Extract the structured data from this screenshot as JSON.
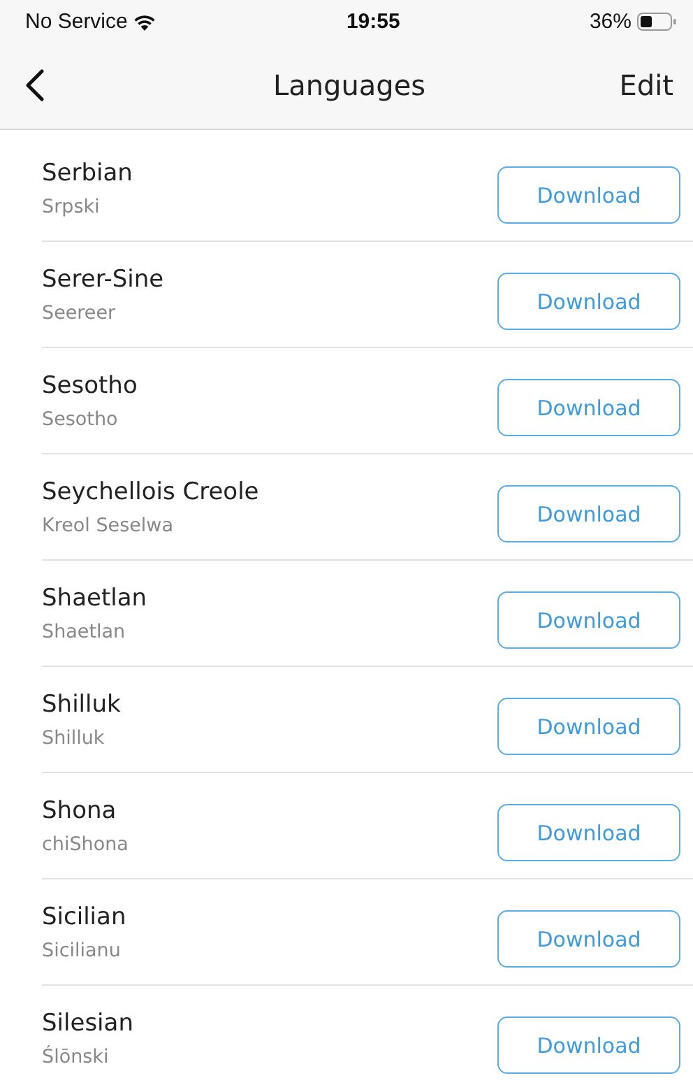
{
  "status_bar": {
    "carrier": "No Service",
    "time": "19:55",
    "battery": "36%"
  },
  "nav": {
    "title": "Languages",
    "action": "Edit"
  },
  "languages": [
    {
      "name": "Serbian",
      "native": "Srpski",
      "action": "Download"
    },
    {
      "name": "Serer-Sine",
      "native": "Seereer",
      "action": "Download"
    },
    {
      "name": "Sesotho",
      "native": "Sesotho",
      "action": "Download"
    },
    {
      "name": "Seychellois Creole",
      "native": "Kreol Seselwa",
      "action": "Download"
    },
    {
      "name": "Shaetlan",
      "native": "Shaetlan",
      "action": "Download"
    },
    {
      "name": "Shilluk",
      "native": "Shilluk",
      "action": "Download"
    },
    {
      "name": "Shona",
      "native": "chiShona",
      "action": "Download"
    },
    {
      "name": "Sicilian",
      "native": "Sicilianu",
      "action": "Download"
    },
    {
      "name": "Silesian",
      "native": "Ślōnski",
      "action": "Download"
    }
  ]
}
